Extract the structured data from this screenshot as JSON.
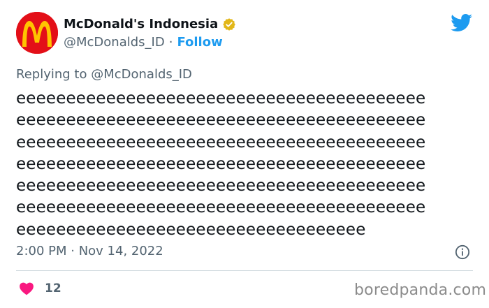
{
  "author": {
    "display_name": "McDonald's Indonesia",
    "handle": "@McDonalds_ID",
    "separator": "·",
    "follow_label": "Follow"
  },
  "reply": {
    "prefix": "Replying to ",
    "mention": "@McDonalds_ID"
  },
  "tweet": {
    "text": "eeeeeeeeeeeeeeeeeeeeeeeeeeeeeeeeeeeeeeeee\neeeeeeeeeeeeeeeeeeeeeeeeeeeeeeeeeeeeeeeee\neeeeeeeeeeeeeeeeeeeeeeeeeeeeeeeeeeeeeeeee\neeeeeeeeeeeeeeeeeeeeeeeeeeeeeeeeeeeeeeeee\neeeeeeeeeeeeeeeeeeeeeeeeeeeeeeeeeeeeeeeee\neeeeeeeeeeeeeeeeeeeeeeeeeeeeeeeeeeeeeeeee\neeeeeeeeeeeeeeeeeeeeeeeeeeeeeeeeeee",
    "timestamp": "2:00 PM · Nov 14, 2022",
    "likes": "12"
  },
  "watermark": "boredpanda.com",
  "icons": {
    "avatar": "mcdonalds-logo",
    "verified": "verified-badge-icon",
    "brand": "twitter-bird-icon",
    "info": "info-icon",
    "like": "heart-icon"
  },
  "colors": {
    "verified_gold": "#e2b719",
    "twitter_blue": "#1d9bf0",
    "like_pink": "#f91880",
    "mcd_red": "#e30f18",
    "mcd_yellow": "#ffc300",
    "secondary_text": "#536471"
  }
}
